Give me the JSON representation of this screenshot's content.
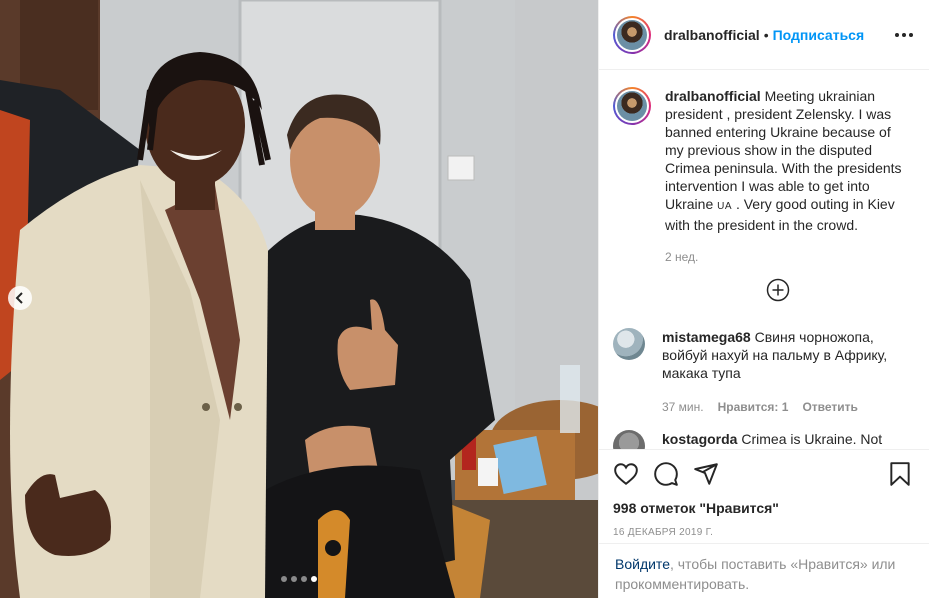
{
  "post": {
    "username": "dralbanofficial",
    "separator": "•",
    "follow_label": "Подписаться"
  },
  "caption": {
    "username": "dralbanofficial",
    "text_before_flag": "Meeting ukrainian president , president Zelensky. I was banned entering Ukraine because of my previous show in the disputed Crimea peninsula. With the presidents intervention I was able to get into Ukraine",
    "flag": "UA",
    "text_after_flag": ". Very good outing in Kiev with the president in the crowd.",
    "time": "2 нед."
  },
  "comments": [
    {
      "username": "mistamega68",
      "text": "Свиня чорножопа, войбуй нахуй на пальму в Африку, макака тупа",
      "time": "37 мин.",
      "likes": "Нравится: 1",
      "reply": "Ответить"
    },
    {
      "username": "kostagorda",
      "text": "Crimea is Ukraine. Not"
    }
  ],
  "stats": {
    "likes_text": "998 отметок \"Нравится\"",
    "date": "16 ДЕКАБРЯ 2019 Г."
  },
  "login": {
    "link": "Войдите",
    "text": ", чтобы поставить «Нравится» или прокомментировать."
  },
  "carousel": {
    "total": 4,
    "active": 4
  },
  "colors": {
    "accent": "#0095f6",
    "link": "#00376b",
    "muted": "#8e8e8e",
    "text": "#262626"
  },
  "icons": [
    "chevron-left-icon",
    "more-icon",
    "plus-circle-icon",
    "heart-icon",
    "comment-icon",
    "share-icon",
    "bookmark-icon"
  ]
}
